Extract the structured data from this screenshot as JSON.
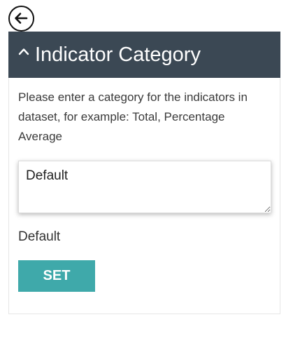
{
  "navigation": {
    "back_icon": "arrow-left-circle-icon"
  },
  "panel": {
    "collapse_icon": "chevron-up-icon",
    "title": "Indicator Category",
    "header_color": "#3b4854",
    "description": "Please enter a category for the indicators in dataset, for example: Total, Percentage Average",
    "category_input": {
      "value": "Default",
      "placeholder": ""
    },
    "current_category": "Default",
    "set_label": "SET",
    "set_color": "#3fa9aa"
  }
}
